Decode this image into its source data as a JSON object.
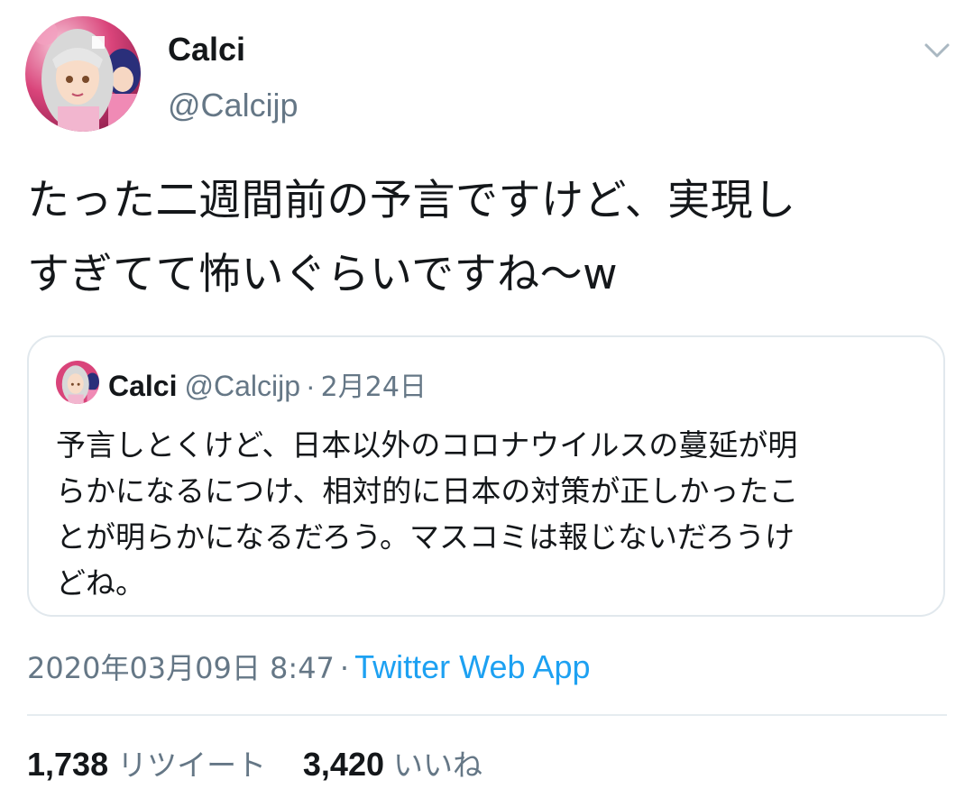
{
  "tweet": {
    "display_name": "Calci",
    "handle": "@Calcijp",
    "text": "たった二週間前の予言ですけど、実現し\nすぎてて怖いぐらいですね〜w",
    "timestamp": "2020年03月09日 8:47",
    "separator": "·",
    "source": "Twitter Web App"
  },
  "quote": {
    "display_name": "Calci",
    "handle": "@Calcijp",
    "separator": "·",
    "date": "2月24日",
    "text": "予言しとくけど、日本以外のコロナウイルスの蔓延が明\nらかになるにつけ、相対的に日本の対策が正しかったこ\nとが明らかになるだろう。マスコミは報じないだろうけ\nどね。"
  },
  "stats": {
    "retweets_count": "1,738",
    "retweets_label": "リツイート",
    "likes_count": "3,420",
    "likes_label": "いいね"
  },
  "icons": {
    "menu": "chevron-down-icon",
    "avatar": "avatar-image"
  },
  "colors": {
    "text": "#14171a",
    "secondary": "#657786",
    "link": "#1da1f2",
    "border": "#e1e8ed"
  }
}
